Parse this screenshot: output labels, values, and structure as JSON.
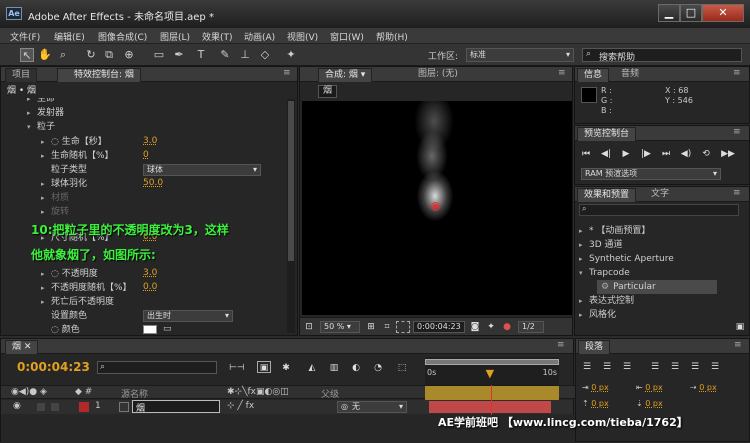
{
  "window": {
    "app_icon": "Ae",
    "title": "Adobe After Effects - 未命名项目.aep *",
    "btn_min": "▁",
    "btn_max": "□",
    "btn_close": "✕"
  },
  "menu": [
    "文件(F)",
    "编辑(E)",
    "图像合成(C)",
    "图层(L)",
    "效果(T)",
    "动画(A)",
    "视图(V)",
    "窗口(W)",
    "帮助(H)"
  ],
  "toolbar": {
    "workspace_label": "工作区:",
    "workspace_value": "标准",
    "search_placeholder": "搜索帮助"
  },
  "left_panel": {
    "tab_project": "项目",
    "tab_effects": "特效控制台: 烟",
    "header": "烟 • 烟",
    "rows": [
      {
        "label": "生命",
        "value": ""
      },
      {
        "label": "发射器",
        "value": ""
      },
      {
        "label": "粒子",
        "value": ""
      },
      {
        "label": "生命【秒】",
        "value": "3.0"
      },
      {
        "label": "生命随机【%】",
        "value": "0"
      },
      {
        "label": "粒子类型",
        "value": "球体"
      },
      {
        "label": "球体羽化",
        "value": "50.0"
      },
      {
        "label": "材质",
        "value": ""
      },
      {
        "label": "旋转",
        "value": ""
      },
      {
        "label": "尺寸随机【%】",
        "value": "0.0"
      },
      {
        "label": "不透明度",
        "value": "3.0"
      },
      {
        "label": "不透明度随机【%】",
        "value": "0.0"
      },
      {
        "label": "死亡后不透明度",
        "value": ""
      },
      {
        "label": "设置颜色",
        "value": "出生时"
      },
      {
        "label": "颜色",
        "value": ""
      }
    ],
    "overlay_line1": "10:把粒子里的不透明度改为3，这样",
    "overlay_line2": "他就象烟了，如图所示:"
  },
  "comp_panel": {
    "tab_comp": "合成: 烟",
    "tab_layer": "图层: (无)",
    "comp_name": "烟",
    "zoom": "50 %",
    "timecode": "0:00:04:23",
    "resolution": "1/2"
  },
  "info_panel": {
    "tab_info": "信息",
    "tab_audio": "音频",
    "r": "R :",
    "g": "G :",
    "b": "B :",
    "x": "X : 68",
    "y": "Y : 546"
  },
  "preview_panel": {
    "tab": "预览控制台",
    "ram_option": "RAM 预渲选项"
  },
  "effects_panel": {
    "tab_effects": "效果和预置",
    "tab_text": "文字",
    "items": [
      {
        "label": "* 【动画预置】",
        "indent": 0
      },
      {
        "label": "3D 通道",
        "indent": 0
      },
      {
        "label": "Synthetic Aperture",
        "indent": 0
      },
      {
        "label": "Trapcode",
        "indent": 0
      },
      {
        "label": "Particular",
        "indent": 1
      },
      {
        "label": "表达式控制",
        "indent": 0
      },
      {
        "label": "风格化",
        "indent": 0
      }
    ]
  },
  "timeline": {
    "tab": "烟",
    "timecode": "0:00:04:23",
    "col_name": "源名称",
    "col_switches": "父级",
    "layer_num": "1",
    "layer_name": "烟",
    "parent": "无",
    "ruler_start": "0s",
    "ruler_end": "10s",
    "playhead": 0.49
  },
  "paragraph_panel": {
    "tab": "段落",
    "px_values": [
      "0 px",
      "0 px",
      "0 px",
      "0 px",
      "0 px"
    ]
  },
  "watermark": "AE学前班吧 【www.lincg.com/tieba/1762】",
  "colors": {
    "accent_orange": "#e0a020",
    "overlay_green": "#3df03d",
    "timeline_bar": "#c04848"
  }
}
